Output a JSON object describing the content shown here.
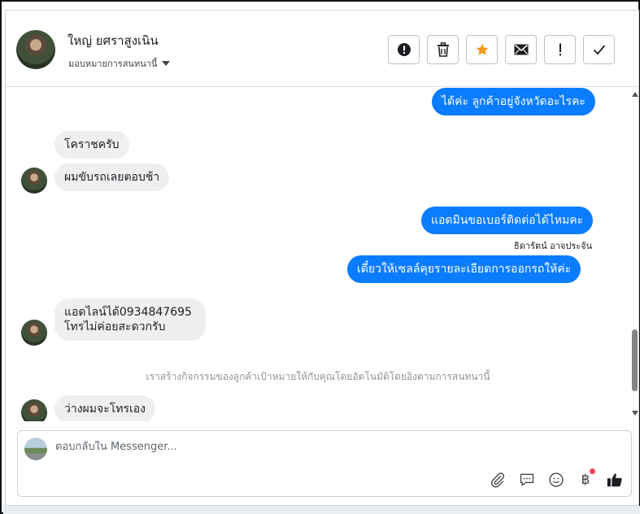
{
  "header": {
    "contact_name": "ใหญ่ ยศราสูงเนิน",
    "assign_label": "มอบหมายการสนทนานี้",
    "actions": [
      {
        "name": "spam-button",
        "icon": "alert-circle-icon"
      },
      {
        "name": "delete-button",
        "icon": "trash-icon"
      },
      {
        "name": "star-button",
        "icon": "star-icon"
      },
      {
        "name": "mark-unread-button",
        "icon": "envelope-icon"
      },
      {
        "name": "follow-up-button",
        "icon": "exclamation-icon"
      },
      {
        "name": "mark-done-button",
        "icon": "checkmark-icon"
      }
    ]
  },
  "messages": {
    "m1": "ได้ค่ะ ลูกค้าอยู่จังหวัดอะไรคะ",
    "m2": "โคราชครับ",
    "m3": "ผมขับรถเลยตอบช้า",
    "m4": "แอดมินขอเบอร์ติดต่อได้ไหมคะ",
    "m4_sender": "ธิดารัตน์ อาจประจัน",
    "m5": "เดี๋ยวให้เซลล์คุยรายละเอียดการออกรถให้ค่ะ",
    "m6_line1": "แอดไลน์ได้0934847695",
    "m6_line2": "โทรไม่ค่อยสะดวกรับ",
    "system_note": "เราสร้างกิจกรรมของลูกค้าเป้าหมายให้กับคุณโดยอัตโนมัติโดยอิงตามการสนทนานี้",
    "m7": "ว่างผมจะโทรเอง"
  },
  "composer": {
    "placeholder": "ตอบกลับใน Messenger...",
    "currency_symbol": "฿"
  },
  "colors": {
    "outgoing_bubble": "#0a7cff",
    "incoming_bubble": "#eeeff1",
    "star": "#f39a1e",
    "notification_dot": "#f3425f"
  }
}
